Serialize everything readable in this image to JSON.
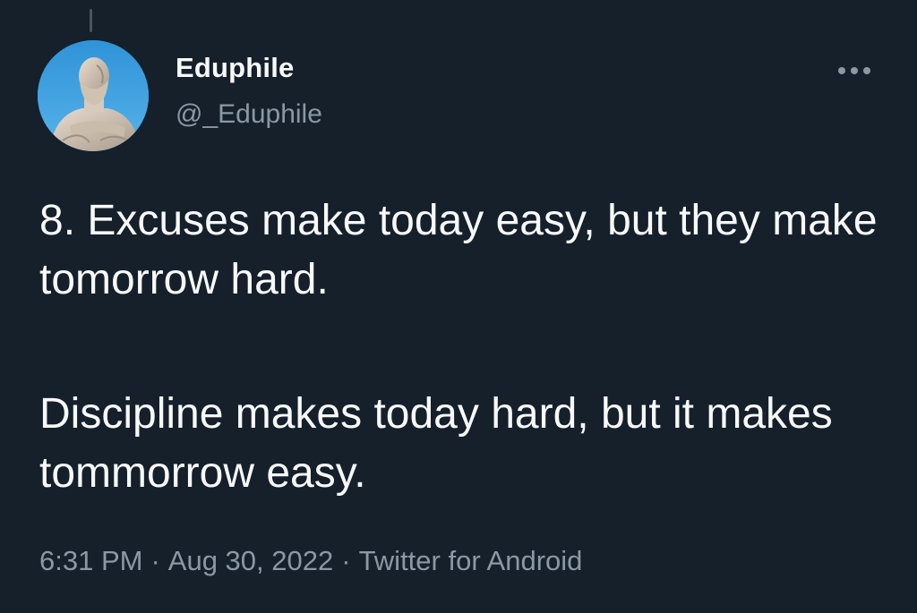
{
  "tweet": {
    "author": {
      "display_name": "Eduphile",
      "handle": "@_Eduphile",
      "avatar_icon": "statue-avatar"
    },
    "more_icon": "more-horizontal-icon",
    "text_paragraphs": [
      "8. Excuses make today easy, but they make tomorrow hard.",
      "Discipline makes today hard, but it makes tommorrow easy."
    ],
    "meta": {
      "time": "6:31 PM",
      "separator": "·",
      "date": "Aug 30, 2022",
      "source": "Twitter for Android"
    }
  },
  "colors": {
    "background": "#15202b",
    "text_primary": "#f7f9f9",
    "text_secondary": "#8b98a5",
    "avatar_sky": "#3b9ede"
  }
}
